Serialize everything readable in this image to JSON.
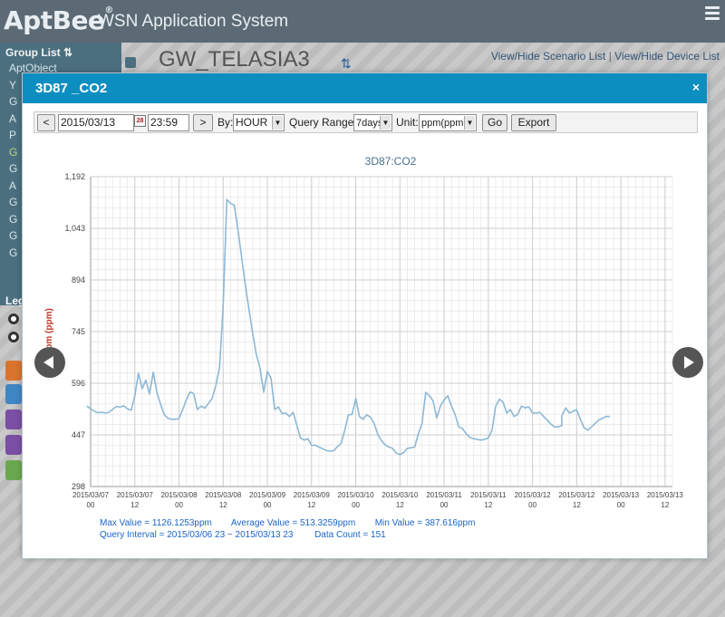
{
  "app": {
    "logo": "AptBee",
    "logo_mark": "®",
    "title": "WSN Application System"
  },
  "sidebar": {
    "group_list_label": "Group List",
    "group_list_sort_icon": "sort-icon",
    "items": [
      "AptObject",
      "Y",
      "G",
      "A",
      "P",
      "G",
      "G",
      "A",
      "G",
      "G",
      "G",
      "G"
    ],
    "legend_label": "Leg"
  },
  "background": {
    "page_title": "GW_TELASIA3",
    "link_scenario": "View/Hide Scenario List",
    "link_separator": "|",
    "link_device": "View/Hide Device List"
  },
  "modal": {
    "title": "3D87 _CO2",
    "close_label": "×",
    "toolbar": {
      "prev_label": "<",
      "date_value": "2015/03/13",
      "calendar_icon_text": "28",
      "time_value": "23:59",
      "next_label": ">",
      "by_label": "By:",
      "by_value": "HOUR",
      "range_label": "Query Range:",
      "range_value": "7days",
      "unit_label": "Unit:",
      "unit_value": "ppm(ppm)",
      "go_label": "Go",
      "export_label": "Export"
    },
    "stats": {
      "max": "Max Value = 1126.1253ppm",
      "avg": "Average Value = 513.3259ppm",
      "min": "Min Value = 387.616ppm",
      "interval": "Query Interval = 2015/03/06 23 ~ 2015/03/13 23",
      "count": "Data Count = 151"
    }
  },
  "colors": {
    "header": "#5b6a74",
    "modal_header": "#0d8ec0",
    "line": "#8db8d6",
    "ylabel": "#c0392b",
    "stats": "#1a64c8"
  },
  "chart_data": {
    "type": "line",
    "title": "3D87:CO2",
    "ylabel": "ppm (ppm)",
    "xlabel": "",
    "ylim": [
      298,
      1192
    ],
    "yticks": [
      298,
      447,
      596,
      745,
      894,
      1043,
      1192
    ],
    "ytick_labels": [
      "298",
      "447",
      "596",
      "745",
      "894",
      "1,043",
      "1,192"
    ],
    "xlim": [
      0,
      158
    ],
    "xticks": [
      {
        "x": 0,
        "l1": "2015/03/07",
        "l2": "00"
      },
      {
        "x": 12,
        "l1": "2015/03/07",
        "l2": "12"
      },
      {
        "x": 24,
        "l1": "2015/03/08",
        "l2": "00"
      },
      {
        "x": 36,
        "l1": "2015/03/08",
        "l2": "12"
      },
      {
        "x": 48,
        "l1": "2015/03/09",
        "l2": "00"
      },
      {
        "x": 60,
        "l1": "2015/03/09",
        "l2": "12"
      },
      {
        "x": 72,
        "l1": "2015/03/10",
        "l2": "00"
      },
      {
        "x": 84,
        "l1": "2015/03/10",
        "l2": "12"
      },
      {
        "x": 96,
        "l1": "2015/03/11",
        "l2": "00"
      },
      {
        "x": 108,
        "l1": "2015/03/11",
        "l2": "12"
      },
      {
        "x": 120,
        "l1": "2015/03/12",
        "l2": "00"
      },
      {
        "x": 132,
        "l1": "2015/03/12",
        "l2": "12"
      },
      {
        "x": 144,
        "l1": "2015/03/13",
        "l2": "00"
      },
      {
        "x": 156,
        "l1": "2015/03/13",
        "l2": "12"
      }
    ],
    "x": [
      -1,
      0,
      1,
      2,
      3,
      4,
      5,
      6,
      7,
      8,
      9,
      10,
      11,
      12,
      13,
      14,
      15,
      16,
      17,
      18,
      19,
      20,
      21,
      22,
      23,
      24,
      25,
      26,
      27,
      28,
      29,
      30,
      31,
      32,
      33,
      34,
      35,
      36,
      37,
      38,
      39,
      40,
      41,
      42,
      43,
      44,
      45,
      46,
      47,
      48,
      49,
      50,
      51,
      52,
      53,
      54,
      55,
      56,
      57,
      58,
      59,
      60,
      61,
      62,
      63,
      64,
      65,
      66,
      67,
      68,
      69,
      70,
      71,
      72,
      73,
      74,
      75,
      76,
      77,
      78,
      79,
      80,
      81,
      82,
      83,
      84,
      85,
      86,
      87,
      88,
      89,
      90,
      91,
      92,
      93,
      94,
      95,
      96,
      97,
      98,
      99,
      100,
      101,
      102,
      103,
      104,
      105,
      106,
      107,
      108,
      109,
      110,
      111,
      112,
      113,
      114,
      115,
      116,
      117,
      118,
      119,
      120,
      121,
      122,
      123,
      124,
      125,
      126,
      127,
      128,
      127.9,
      129,
      130,
      131,
      132,
      133,
      134,
      135,
      136,
      137,
      138,
      139,
      140,
      141,
      142,
      143,
      144,
      145,
      146,
      147,
      148,
      149,
      150,
      151,
      152,
      153,
      154,
      155,
      156,
      157,
      158
    ],
    "values": [
      530,
      522,
      515,
      511,
      512,
      510,
      512,
      521,
      529,
      527,
      531,
      522,
      518,
      560,
      625,
      580,
      605,
      565,
      628,
      570,
      535,
      505,
      495,
      492,
      492,
      494,
      520,
      548,
      571,
      566,
      520,
      530,
      524,
      538,
      552,
      590,
      640,
      820,
      1126,
      1115,
      1110,
      1040,
      960,
      880,
      810,
      740,
      680,
      640,
      570,
      630,
      610,
      520,
      528,
      508,
      510,
      500,
      512,
      475,
      438,
      432,
      436,
      417,
      417,
      412,
      407,
      402,
      400,
      401,
      413,
      422,
      460,
      505,
      506,
      552,
      500,
      492,
      505,
      498,
      480,
      448,
      430,
      418,
      412,
      408,
      394,
      390,
      396,
      408,
      410,
      412,
      450,
      480,
      570,
      560,
      545,
      496,
      530,
      548,
      560,
      530,
      505,
      470,
      465,
      450,
      440,
      436,
      434,
      432,
      434,
      438,
      460,
      530,
      550,
      542,
      510,
      520,
      500,
      506,
      530,
      525,
      528,
      510,
      510,
      512,
      500,
      490,
      478,
      470,
      470,
      475,
      500,
      525,
      510,
      515,
      520,
      492,
      468,
      460,
      470,
      480,
      490,
      495,
      500,
      500
    ],
    "line_color": "#8db8d6",
    "grid": true
  }
}
